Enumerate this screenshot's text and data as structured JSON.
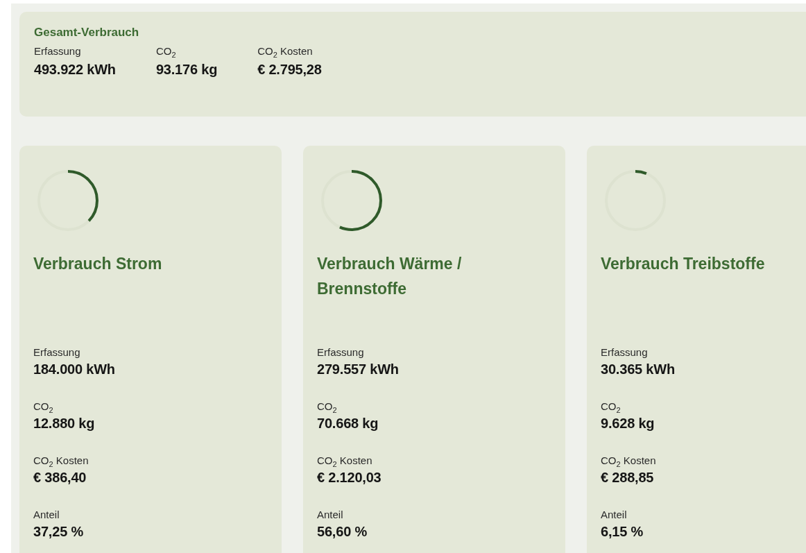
{
  "summary": {
    "title": "Gesamt-Verbrauch",
    "metrics": [
      {
        "label": "Erfassung",
        "value": "493.922 kWh"
      },
      {
        "label": "CO$_{2}$",
        "value": "93.176 kg"
      },
      {
        "label": "CO$_{2}$ Kosten",
        "value": "€ 2.795,28"
      }
    ]
  },
  "cards": [
    {
      "title": "Verbrauch Strom",
      "level": 0.3725,
      "metrics": [
        {
          "label": "Erfassung",
          "value": "184.000 kWh"
        },
        {
          "label": "CO$_{2}$",
          "value": "12.880 kg"
        },
        {
          "label": "CO$_{2}$ Kosten",
          "value": "€ 386,40"
        },
        {
          "label": "Anteil",
          "value": "37,25 %"
        }
      ]
    },
    {
      "title": "Verbrauch Wärme / Brennstoffe",
      "level": 0.566,
      "metrics": [
        {
          "label": "Erfassung",
          "value": "279.557 kWh"
        },
        {
          "label": "CO$_{2}$",
          "value": "70.668 kg"
        },
        {
          "label": "CO$_{2}$ Kosten",
          "value": "€ 2.120,03"
        },
        {
          "label": "Anteil",
          "value": "56,60 %"
        }
      ]
    },
    {
      "title": "Verbrauch Treibstoffe",
      "level": 0.0615,
      "metrics": [
        {
          "label": "Erfassung",
          "value": "30.365 kWh"
        },
        {
          "label": "CO$_{2}$",
          "value": "9.628 kg"
        },
        {
          "label": "CO$_{2}$ Kosten",
          "value": "€ 288,85"
        },
        {
          "label": "Anteil",
          "value": "6,15 %"
        }
      ]
    }
  ]
}
